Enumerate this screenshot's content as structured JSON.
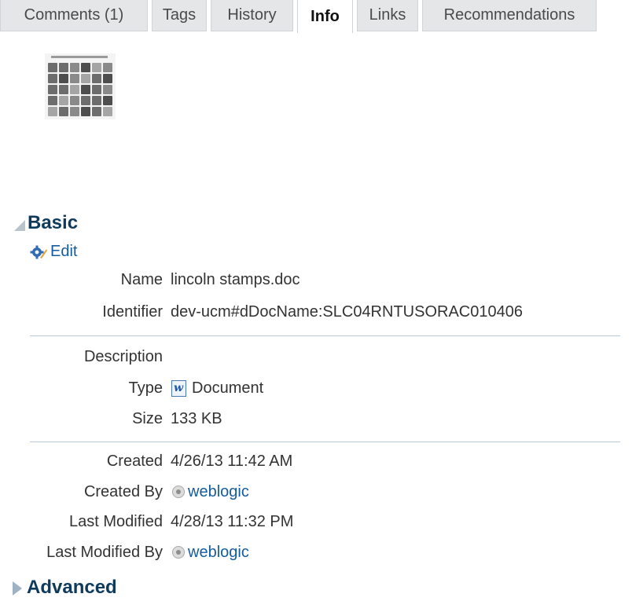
{
  "tabs": [
    {
      "label": "Comments (1)",
      "active": false
    },
    {
      "label": "Tags",
      "active": false
    },
    {
      "label": "History",
      "active": false
    },
    {
      "label": "Info",
      "active": true
    },
    {
      "label": "Links",
      "active": false
    },
    {
      "label": "Recommendations",
      "active": false
    }
  ],
  "basic": {
    "title": "Basic",
    "expanded": true,
    "edit_label": "Edit",
    "name_label": "Name",
    "name_value": "lincoln stamps.doc",
    "identifier_label": "Identifier",
    "identifier_value": "dev-ucm#dDocName:SLC04RNTUSORAC010406",
    "description_label": "Description",
    "description_value": "",
    "type_label": "Type",
    "type_value": "Document",
    "type_icon": "word-document-icon",
    "size_label": "Size",
    "size_value": "133 KB",
    "created_label": "Created",
    "created_value": "4/26/13 11:42 AM",
    "created_by_label": "Created By",
    "created_by_value": "weblogic",
    "last_modified_label": "Last Modified",
    "last_modified_value": "4/28/13 11:32 PM",
    "last_modified_by_label": "Last Modified By",
    "last_modified_by_value": "weblogic"
  },
  "advanced": {
    "title": "Advanced",
    "expanded": false
  },
  "colors": {
    "link": "#145c9e",
    "section_title": "#0e3a5c",
    "tab_background": "#e4e6e8",
    "divider": "#b9c9d8"
  }
}
